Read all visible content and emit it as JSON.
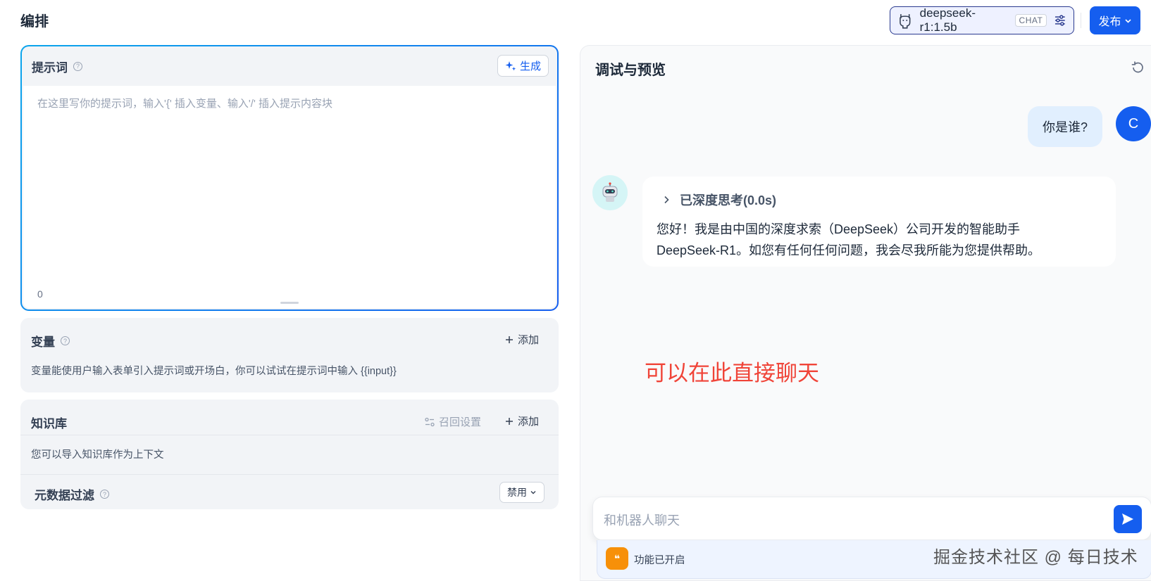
{
  "header": {
    "title": "编排",
    "model": {
      "name": "deepseek-r1:1.5b",
      "badge": "CHAT"
    },
    "publish_label": "发布"
  },
  "prompt": {
    "title": "提示词",
    "generate_label": "生成",
    "placeholder": "在这里写你的提示词，输入'{' 插入变量、输入'/' 插入提示内容块",
    "char_count": "0"
  },
  "variables": {
    "title": "变量",
    "add_label": "添加",
    "description": "变量能使用户输入表单引入提示词或开场白，你可以试试在提示词中输入 {{input}}"
  },
  "knowledge": {
    "title": "知识库",
    "recall_label": "召回设置",
    "add_label": "添加",
    "description": "您可以导入知识库作为上下文",
    "metadata_filter": {
      "title": "元数据过滤",
      "value": "禁用"
    }
  },
  "debug": {
    "title": "调试与预览",
    "messages": [
      {
        "role": "user",
        "avatar": "C",
        "text": "你是谁?"
      },
      {
        "role": "assistant",
        "thinking": "已深度思考(0.0s)",
        "text": "您好！我是由中国的深度求索（DeepSeek）公司开发的智能助手DeepSeek-R1。如您有任何任何问题，我会尽我所能为您提供帮助。"
      }
    ],
    "annotation": "可以在此直接聊天",
    "input_placeholder": "和机器人聊天",
    "feature_status": "功能已开启"
  },
  "watermark": "掘金技术社区 @ 每日技术",
  "colors": {
    "accent": "#155eef",
    "annotation": "#f04438",
    "feature": "#f79009"
  }
}
